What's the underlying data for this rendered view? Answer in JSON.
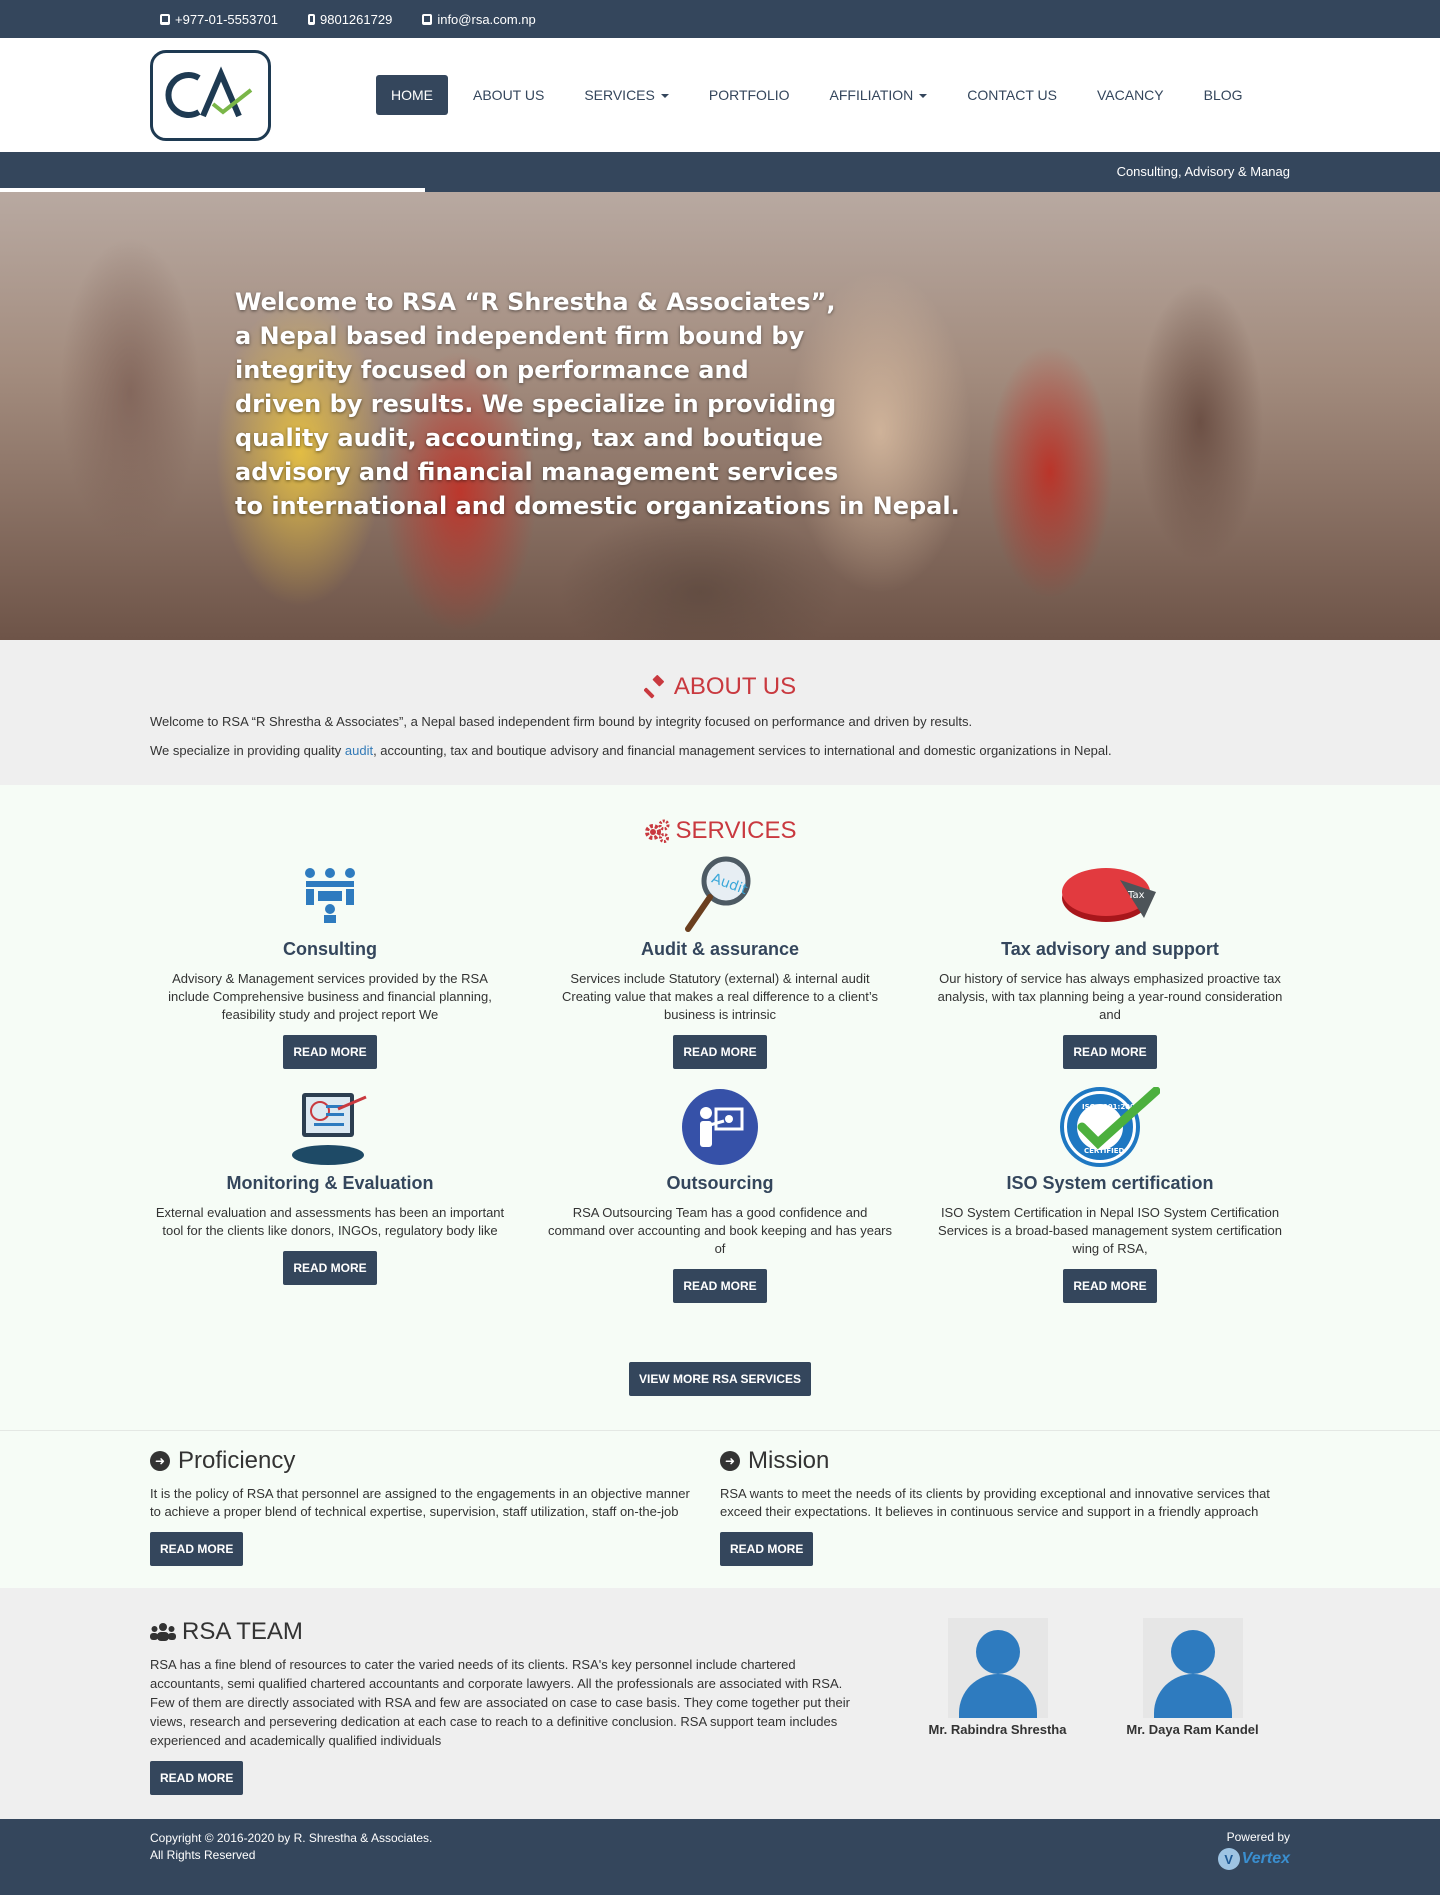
{
  "topbar": {
    "phone": "+977-01-5553701",
    "mobile": "9801261729",
    "email": "info@rsa.com.np"
  },
  "nav": {
    "items": [
      {
        "label": "HOME",
        "active": true
      },
      {
        "label": "ABOUT US"
      },
      {
        "label": "SERVICES",
        "dropdown": true
      },
      {
        "label": "PORTFOLIO"
      },
      {
        "label": "AFFILIATION",
        "dropdown": true
      },
      {
        "label": "CONTACT US"
      },
      {
        "label": "VACANCY"
      },
      {
        "label": "BLOG"
      }
    ]
  },
  "ticker": {
    "text": "Consulting, Advisory & Manag"
  },
  "hero": {
    "lines": [
      "Welcome to RSA “R Shrestha & Associates”,",
      "a Nepal based independent firm bound by",
      "integrity focused on performance and",
      "driven by results. We specialize in providing",
      "quality audit, accounting, tax and boutique",
      "advisory and financial management services",
      "to international and domestic organizations in Nepal."
    ]
  },
  "about": {
    "title": "ABOUT US",
    "p1": "Welcome to RSA “R Shrestha & Associates”, a Nepal based independent firm bound by integrity focused on performance and driven by results.",
    "p2_before": "We specialize in providing quality ",
    "p2_link": "audit",
    "p2_after": ", accounting, tax and boutique advisory and financial management services to international and domestic organizations in Nepal."
  },
  "services": {
    "title": "SERVICES",
    "read_more": "READ MORE",
    "items": [
      {
        "icon": "meeting-icon",
        "title": "Consulting",
        "text": "Advisory & Management services provided by the RSA include Comprehensive business and financial planning, feasibility study and project report We"
      },
      {
        "icon": "magnifier-audit-icon",
        "title": "Audit & assurance",
        "text": "Services include Statutory (external) & internal audit Creating value that makes a real difference to a client’s business is intrinsic"
      },
      {
        "icon": "tax-pie-icon",
        "title": "Tax advisory and support",
        "text": "Our history of service has always emphasized proactive tax analysis, with tax planning being a year-round consideration and"
      },
      {
        "icon": "monitor-icon",
        "title": "Monitoring & Evaluation",
        "text": "External evaluation and assessments has been an important tool for the clients like donors, INGOs, regulatory body like"
      },
      {
        "icon": "presenter-icon",
        "title": "Outsourcing",
        "text": "RSA Outsourcing Team has a good confidence and command over accounting and book keeping and has years of"
      },
      {
        "icon": "iso-badge-icon",
        "title": "ISO System certification",
        "text": "ISO System Certification in Nepal ISO System Certification Services is a broad-based management system certification wing of RSA,"
      }
    ],
    "view_more": "VIEW MORE RSA SERVICES",
    "iso_badge_text": "ISO 9001:2008",
    "iso_badge_sub": "CERTIFIED",
    "tax_label": "Tax",
    "audit_label": "Audit"
  },
  "proficiency": {
    "title": "Proficiency",
    "text": "It is the policy of RSA that personnel are assigned to the engagements in an objective manner to achieve a proper blend of technical expertise, supervision, staff utilization, staff on-the-job",
    "button": "READ MORE"
  },
  "mission": {
    "title": "Mission",
    "text": "RSA wants to meet the needs of its clients by providing exceptional and innovative services that exceed their expectations. It believes in continuous service and support in a friendly approach",
    "button": "READ MORE"
  },
  "team": {
    "title": "RSA TEAM",
    "text": "RSA has a fine blend of resources to cater the varied needs of its clients. RSA's key personnel include chartered accountants, semi qualified chartered accountants and corporate lawyers. All the professionals are associated with RSA. Few of them are directly associated with RSA and few are associated on case to case basis. They come together put their views, research and persevering dedication at each case to reach to a definitive conclusion. RSA support team includes experienced and academically qualified individuals",
    "button": "READ MORE",
    "members": [
      {
        "name": "Mr. Rabindra Shrestha"
      },
      {
        "name": "Mr. Daya Ram Kandel"
      }
    ]
  },
  "footer": {
    "copyright": "Copyright © 2016-2020 by R. Shrestha & Associates.",
    "rights": "All Rights Reserved",
    "powered": "Powered by",
    "brand": "Vertex"
  },
  "colors": {
    "primary": "#34465c",
    "accent": "#c9393f",
    "link": "#337ab7"
  }
}
